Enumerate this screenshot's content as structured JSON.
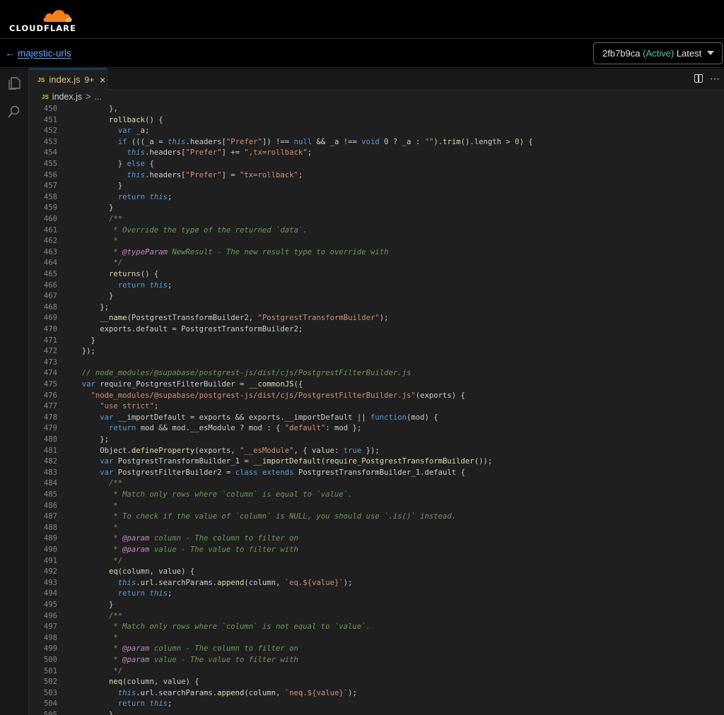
{
  "header": {
    "brand": "CLOUDFLARE",
    "back_label": "majestic-urls",
    "version": {
      "id": "2fb7b9ca",
      "status": "(Active)",
      "tag": "Latest"
    }
  },
  "icons": {
    "back": "arrow-left-icon",
    "explorer": "files-icon",
    "search": "search-icon",
    "split": "split-editor-icon",
    "more": "more-actions-icon"
  },
  "editor": {
    "tab": {
      "badge": "JS",
      "label": "index.js",
      "problems": "9+",
      "close": "×"
    },
    "breadcrumb": {
      "badge": "JS",
      "file": "index.js",
      "sep": ">",
      "more": "..."
    },
    "colors": {
      "keyword": "#569cd6",
      "string": "#ce9178",
      "comment": "#6a9955",
      "function": "#dcdcaa",
      "this": "#569cd6"
    }
  },
  "code": {
    "start": 450,
    "lines": [
      "        },",
      "        rollback() {",
      "          var _a;",
      "          if (((_a = this.headers[\"Prefer\"]) !== null && _a !== void 0 ? _a : \"\").trim().length > 0) {",
      "            this.headers[\"Prefer\"] += \",tx=rollback\";",
      "          } else {",
      "            this.headers[\"Prefer\"] = \"tx=rollback\";",
      "          }",
      "          return this;",
      "        }",
      "        /**",
      "         * Override the type of the returned `data`.",
      "         *",
      "         * @typeParam NewResult - The new result type to override with",
      "         */",
      "        returns() {",
      "          return this;",
      "        }",
      "      };",
      "      __name(PostgrestTransformBuilder2, \"PostgrestTransformBuilder\");",
      "      exports.default = PostgrestTransformBuilder2;",
      "    }",
      "  });",
      "",
      "  // node_modules/@supabase/postgrest-js/dist/cjs/PostgrestFilterBuilder.js",
      "  var require_PostgrestFilterBuilder = __commonJS({",
      "    \"node_modules/@supabase/postgrest-js/dist/cjs/PostgrestFilterBuilder.js\"(exports) {",
      "      \"use strict\";",
      "      var __importDefault = exports && exports.__importDefault || function(mod) {",
      "        return mod && mod.__esModule ? mod : { \"default\": mod };",
      "      };",
      "      Object.defineProperty(exports, \"__esModule\", { value: true });",
      "      var PostgrestTransformBuilder_1 = __importDefault(require_PostgrestTransformBuilder());",
      "      var PostgrestFilterBuilder2 = class extends PostgrestTransformBuilder_1.default {",
      "        /**",
      "         * Match only rows where `column` is equal to `value`.",
      "         *",
      "         * To check if the value of `column` is NULL, you should use `.is()` instead.",
      "         *",
      "         * @param column - The column to filter on",
      "         * @param value - The value to filter with",
      "         */",
      "        eq(column, value) {",
      "          this.url.searchParams.append(column, `eq.${value}`);",
      "          return this;",
      "        }",
      "        /**",
      "         * Match only rows where `column` is not equal to `value`.",
      "         *",
      "         * @param column - The column to filter on",
      "         * @param value - The value to filter with",
      "         */",
      "        neq(column, value) {",
      "          this.url.searchParams.append(column, `neq.${value}`);",
      "          return this;",
      "        }"
    ]
  }
}
